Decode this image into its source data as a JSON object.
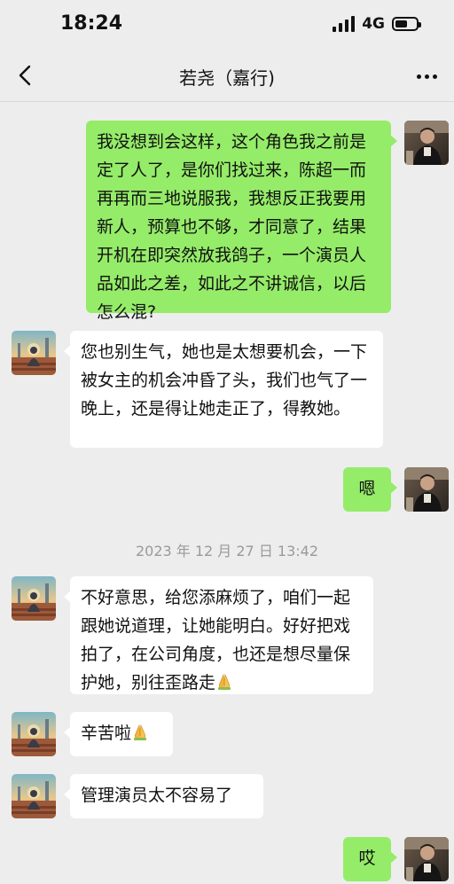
{
  "status_bar": {
    "time": "18:24",
    "network": "4G",
    "battery_level": 0.6
  },
  "nav": {
    "title": "若尧（嘉行)",
    "back_icon": "chevron-left-icon",
    "more_icon": "more-dots-icon"
  },
  "colors": {
    "background": "#ededed",
    "bubble_me": "#95ec69",
    "bubble_them": "#ffffff"
  },
  "messages": [
    {
      "sender": "me",
      "text": "我没想到会这样，这个角色我之前是定了人了，是你们找过来，陈超一而再再而三地说服我，我想反正我要用新人，预算也不够，才同意了，结果开机在即突然放我鸽子，一个演员人品如此之差，如此之不讲诚信，以后怎么混?"
    },
    {
      "sender": "them",
      "text": "您也别生气，她也是太想要机会，一下被女主的机会冲昏了头，我们也气了一晚上，还是得让她走正了，得教她。"
    },
    {
      "sender": "me",
      "text": "嗯"
    },
    {
      "sender": "them",
      "text": "不好意思，给您添麻烦了，咱们一起跟她说道理，让她能明白。好好把戏拍了，在公司角度，也还是想尽量保护她，别往歪路走",
      "emoji": "folded-hands-icon"
    },
    {
      "sender": "them",
      "text": "辛苦啦",
      "emoji": "folded-hands-icon"
    },
    {
      "sender": "them",
      "text": "管理演员太不容易了"
    },
    {
      "sender": "me",
      "text": "哎"
    }
  ],
  "timestamp": "2023 年 12 月 27 日 13:42"
}
